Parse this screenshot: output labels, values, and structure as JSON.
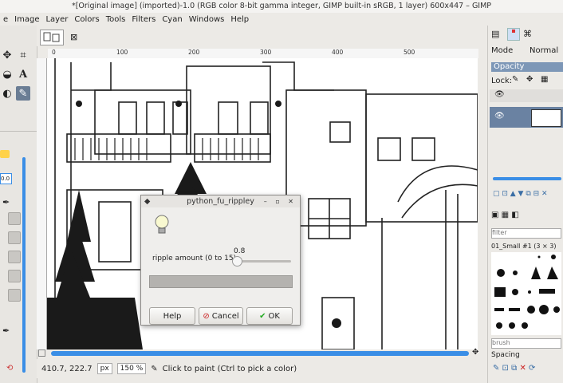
{
  "window": {
    "title": "*[Original image] (imported)-1.0 (RGB color 8-bit gamma integer, GIMP built-in sRGB, 1 layer) 600x447 – GIMP"
  },
  "menu": [
    "e",
    "Image",
    "Layer",
    "Colors",
    "Tools",
    "Filters",
    "Cyan",
    "Windows",
    "Help"
  ],
  "ruler_labels": [
    "0",
    "100",
    "200",
    "300",
    "400",
    "500"
  ],
  "tool_options": {
    "opacity_value": "0.0"
  },
  "status": {
    "coords": "410.7, 222.7",
    "unit": "px",
    "zoom": "150 %",
    "message": "Click to paint (Ctrl to pick a color)"
  },
  "layers": {
    "mode_label": "Mode",
    "mode_value": "Normal",
    "opacity_label": "Opacity",
    "lock_label": "Lock:"
  },
  "brushes": {
    "filter_placeholder": "filter",
    "brush_name": "01_Small #1 (3 × 3)",
    "tag_placeholder": "brush",
    "spacing_label": "Spacing"
  },
  "dialog": {
    "title": "python_fu_rippley",
    "slider_label": "ripple amount (0 to 15)",
    "slider_value": "0.8",
    "slider_fraction": 0.053,
    "help_label": "Help",
    "cancel_label": "Cancel",
    "ok_label": "OK"
  }
}
